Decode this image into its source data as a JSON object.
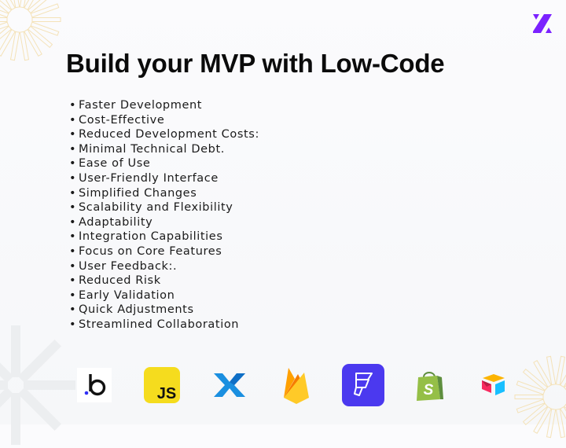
{
  "slide": {
    "title": "Build your MVP with Low-Code",
    "bullet_char": "•",
    "bullets": [
      "Faster Development",
      "Cost-Effective",
      "Reduced Development Costs:",
      "Minimal Technical Debt.",
      "Ease of Use",
      "User-Friendly Interface",
      "Simplified Changes",
      "Scalability and Flexibility",
      "Adaptability",
      "Integration Capabilities",
      "Focus on Core Features",
      "User Feedback:.",
      "Reduced Risk",
      "Early Validation",
      "Quick Adjustments",
      "Streamlined Collaboration"
    ]
  },
  "brand": {
    "logo_icon": "z-logo-icon",
    "accent": "#7b22ff"
  },
  "tool_icons": [
    {
      "name": "bubble-icon",
      "text": "b"
    },
    {
      "name": "javascript-icon",
      "text": "JS"
    },
    {
      "name": "xano-icon"
    },
    {
      "name": "firebase-icon"
    },
    {
      "name": "flutterflow-icon"
    },
    {
      "name": "shopify-icon",
      "text": "S"
    },
    {
      "name": "airtable-icon"
    }
  ]
}
